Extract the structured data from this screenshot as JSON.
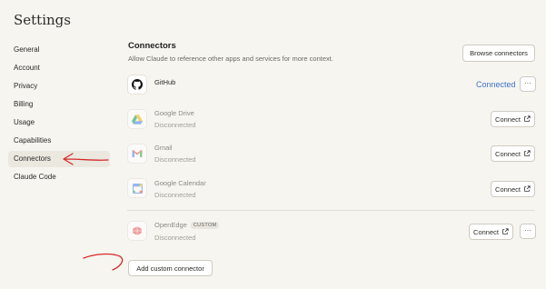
{
  "page": {
    "title": "Settings"
  },
  "sidebar": {
    "items": [
      {
        "label": "General",
        "active": false
      },
      {
        "label": "Account",
        "active": false
      },
      {
        "label": "Privacy",
        "active": false
      },
      {
        "label": "Billing",
        "active": false
      },
      {
        "label": "Usage",
        "active": false
      },
      {
        "label": "Capabilities",
        "active": false
      },
      {
        "label": "Connectors",
        "active": true
      },
      {
        "label": "Claude Code",
        "active": false
      }
    ]
  },
  "connectors": {
    "title": "Connectors",
    "description": "Allow Claude to reference other apps and services for more context.",
    "browse_label": "Browse connectors",
    "github": {
      "name": "GitHub",
      "status": "Connected",
      "more": "···",
      "icon": "github-icon"
    },
    "google_drive": {
      "name": "Google Drive",
      "status": "Disconnected",
      "action": "Connect",
      "icon": "google-drive-icon"
    },
    "gmail": {
      "name": "Gmail",
      "status": "Disconnected",
      "action": "Connect",
      "icon": "gmail-icon"
    },
    "google_calendar": {
      "name": "Google Calendar",
      "status": "Disconnected",
      "action": "Connect",
      "icon": "google-calendar-icon"
    },
    "openedge": {
      "name": "OpenEdge",
      "badge": "CUSTOM",
      "status": "Disconnected",
      "action": "Connect",
      "more": "···",
      "icon": "openedge-icon"
    },
    "add_custom_label": "Add custom connector"
  },
  "colors": {
    "accent": "#3d72c8",
    "background": "#f7f5f0",
    "annotation": "#d42a2a"
  }
}
